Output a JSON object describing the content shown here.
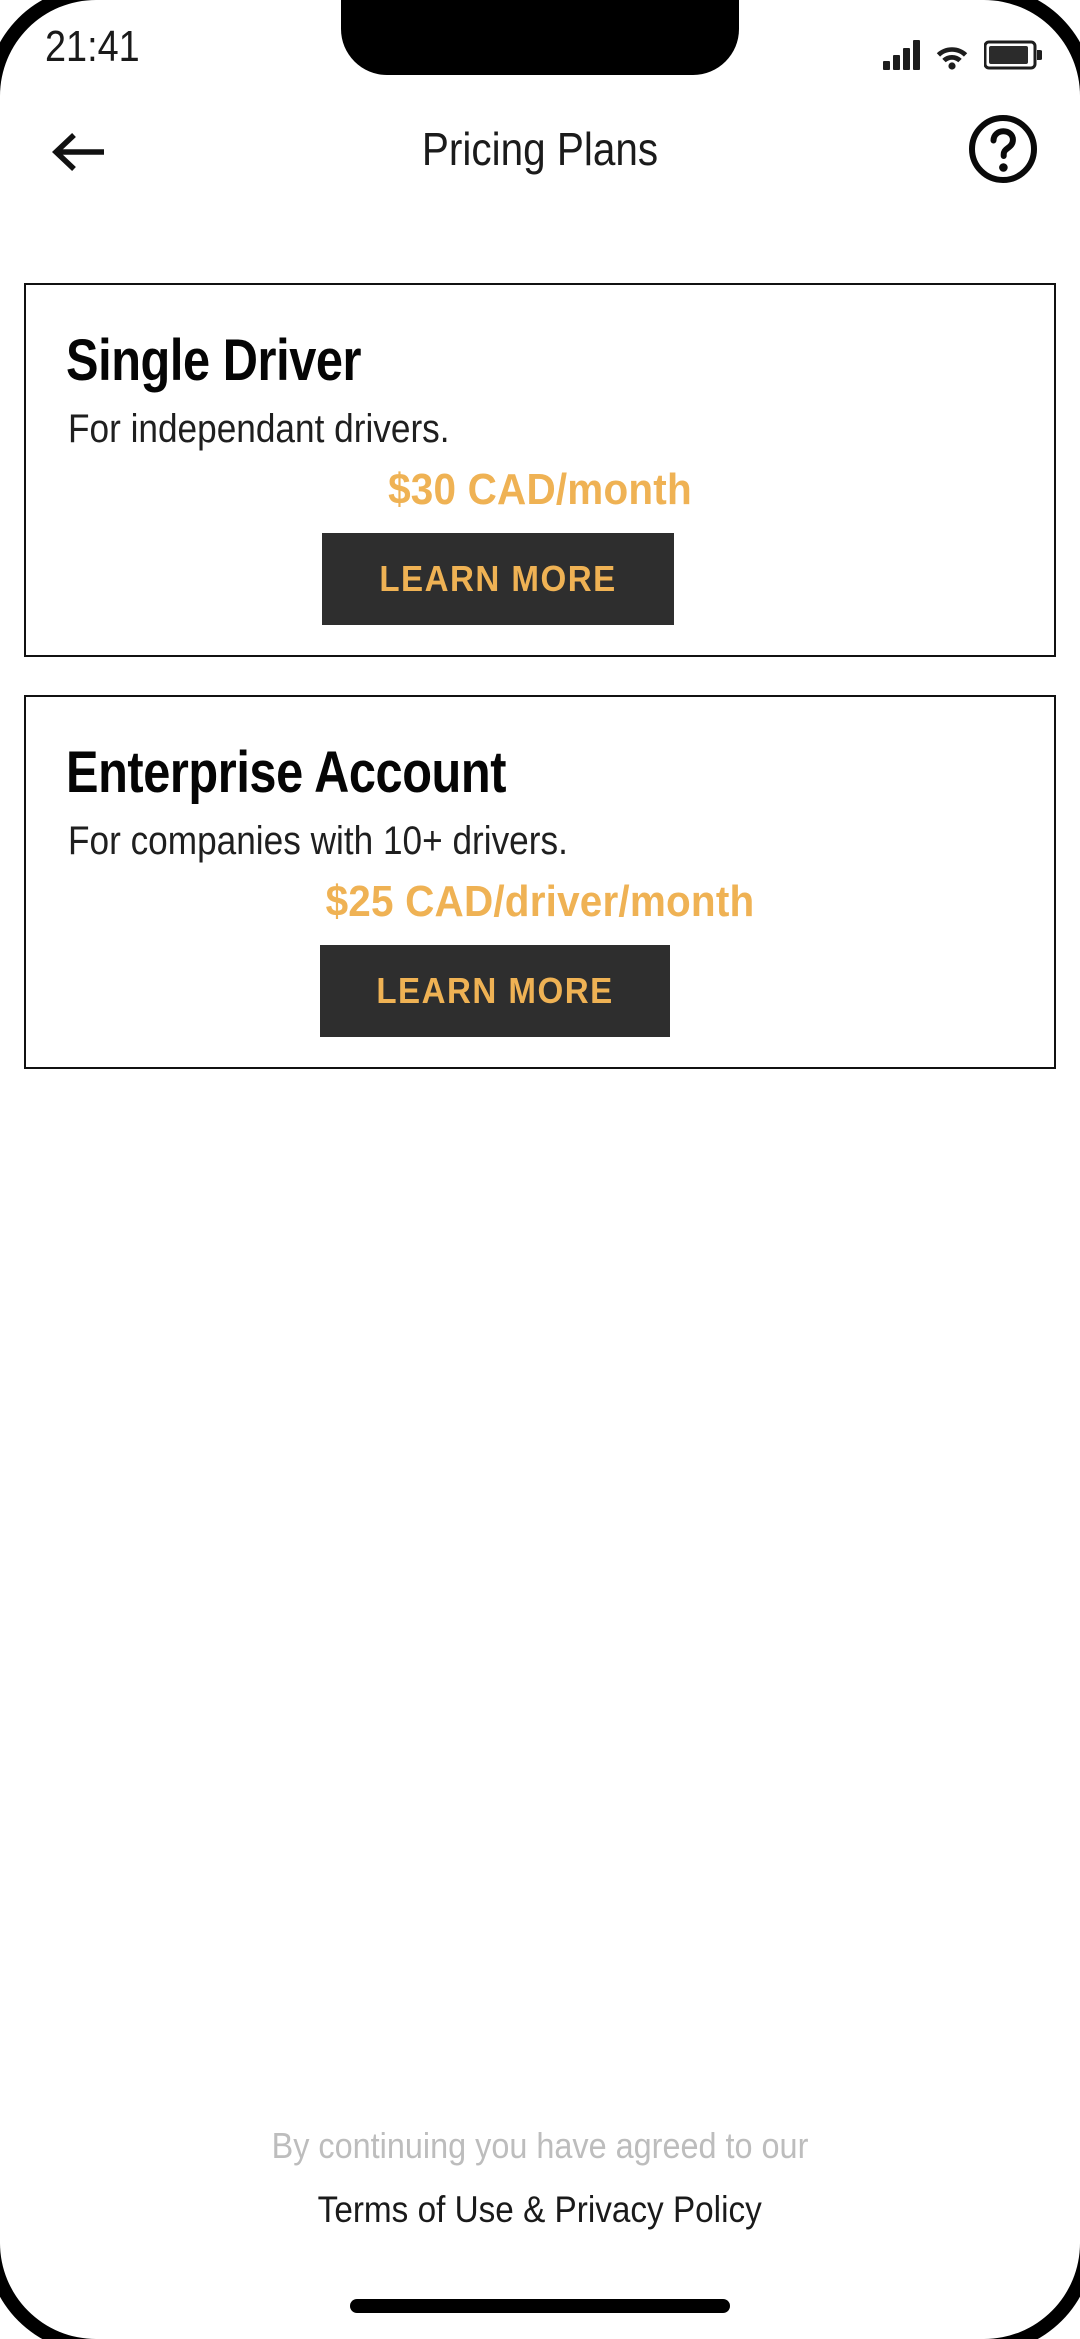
{
  "status_bar": {
    "time": "21:41",
    "signal_icon": "cellular-signal-icon",
    "wifi_icon": "wifi-icon",
    "battery_icon": "battery-icon"
  },
  "header": {
    "back_icon": "back-arrow-icon",
    "title": "Pricing Plans",
    "help_icon": "help-circle-icon"
  },
  "plans": [
    {
      "name": "Single Driver",
      "description": "For independant drivers.",
      "price": "$30 CAD/month",
      "cta_label": "LEARN MORE"
    },
    {
      "name": "Enterprise Account",
      "description": "For companies with 10+ drivers.",
      "price": "$25 CAD/driver/month",
      "cta_label": "LEARN MORE"
    }
  ],
  "footer": {
    "agreement_text": "By continuing you have agreed to our",
    "terms_link": "Terms of Use & Privacy Policy"
  },
  "colors": {
    "accent_amber": "#efb254",
    "button_dark": "#2e2e2e",
    "text_dark": "#111111",
    "text_muted": "#bdbdbd"
  }
}
